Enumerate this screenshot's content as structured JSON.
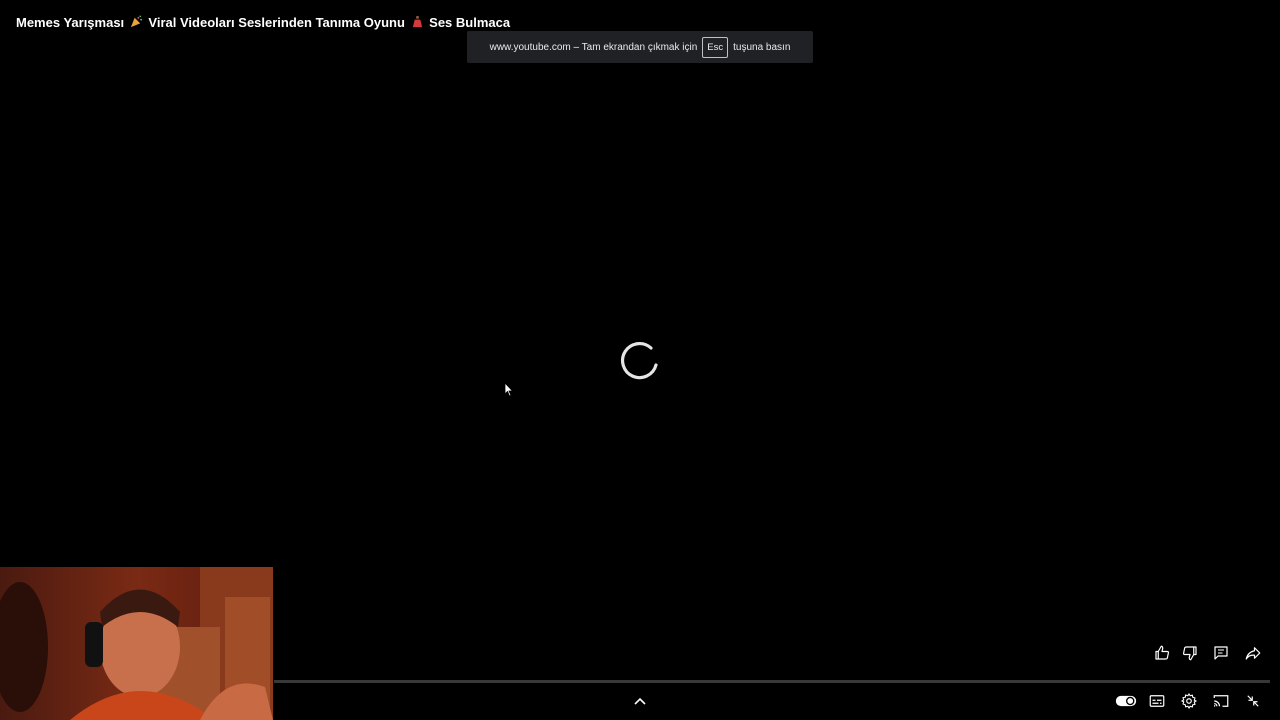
{
  "video": {
    "title_part1": "Memes Yarışması",
    "title_part2": "Viral Videoları Seslerinden Tanıma Oyunu",
    "title_part3": "Ses Bulmaca"
  },
  "fullscreen_toast": {
    "prefix": "www.youtube.com – Tam ekrandan çıkmak için",
    "key": "Esc",
    "suffix": "tuşuna basın"
  },
  "actions": [
    {
      "icon": "thumbs-up-icon"
    },
    {
      "icon": "thumbs-down-icon"
    },
    {
      "icon": "comments-icon"
    },
    {
      "icon": "share-icon"
    }
  ],
  "controls": [
    {
      "icon": "autoplay-toggle-icon"
    },
    {
      "icon": "subtitles-icon"
    },
    {
      "icon": "settings-icon"
    },
    {
      "icon": "cast-icon"
    },
    {
      "icon": "exit-fullscreen-icon"
    }
  ],
  "colors": {
    "background": "#000000",
    "toast_bg": "#202124"
  }
}
